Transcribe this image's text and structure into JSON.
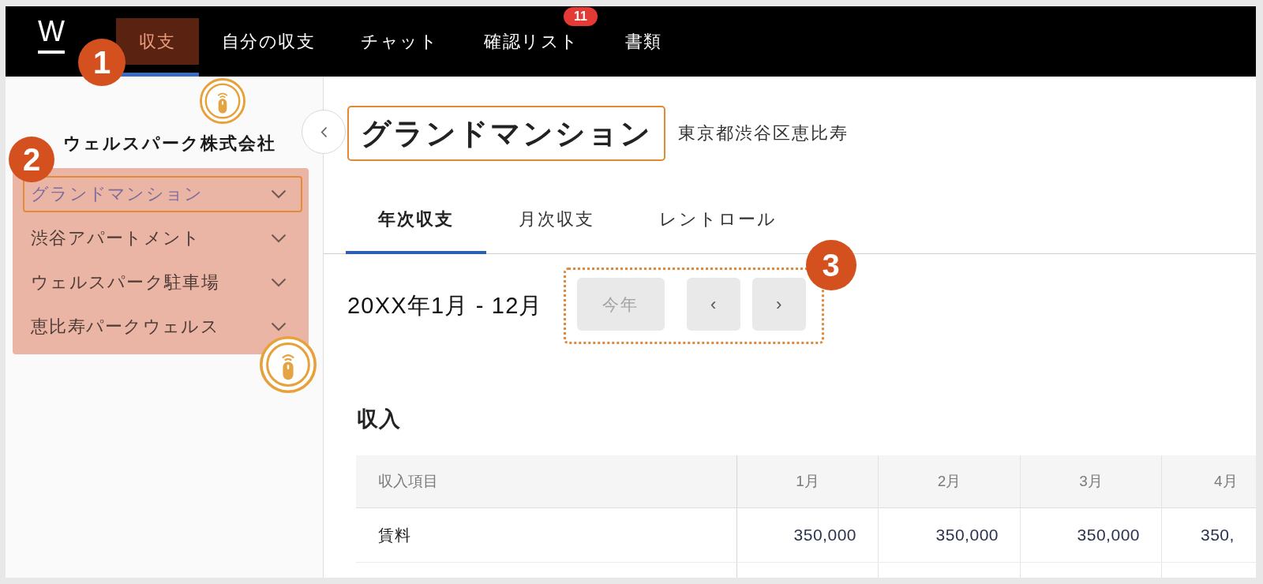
{
  "top_bar": {
    "logo": "W",
    "step_badge": "1",
    "nav": [
      {
        "label": "収支",
        "selected": true
      },
      {
        "label": "自分の収支",
        "selected": false
      },
      {
        "label": "チャット",
        "selected": false
      },
      {
        "label": "確認リスト",
        "selected": false,
        "badge": "11"
      },
      {
        "label": "書類",
        "selected": false
      }
    ]
  },
  "sidebar": {
    "step_badge": "2",
    "company": "ウェルスパーク株式会社",
    "properties": [
      {
        "label": "グランドマンション",
        "selected": true
      },
      {
        "label": "渋谷アパートメント",
        "selected": false
      },
      {
        "label": "ウェルスパーク駐車場",
        "selected": false
      },
      {
        "label": "恵比寿パークウェルス",
        "selected": false
      }
    ]
  },
  "header": {
    "title": "グランドマンション",
    "address": "東京都渋谷区恵比寿"
  },
  "tabs": [
    {
      "label": "年次収支",
      "selected": true
    },
    {
      "label": "月次収支",
      "selected": false
    },
    {
      "label": "レントロール",
      "selected": false
    }
  ],
  "period": {
    "label": "20XX年1月 - 12月",
    "step_badge": "3",
    "buttons": [
      {
        "label": "今年",
        "disabled": true
      },
      {
        "label": "‹",
        "disabled": false
      },
      {
        "label": "›",
        "disabled": false
      }
    ]
  },
  "income": {
    "title": "収入",
    "table": {
      "columns": [
        "収入項目",
        "1月",
        "2月",
        "3月",
        "4月"
      ],
      "rows": [
        [
          "賃料",
          "350,000",
          "350,000",
          "350,000",
          "350,"
        ]
      ]
    }
  }
}
